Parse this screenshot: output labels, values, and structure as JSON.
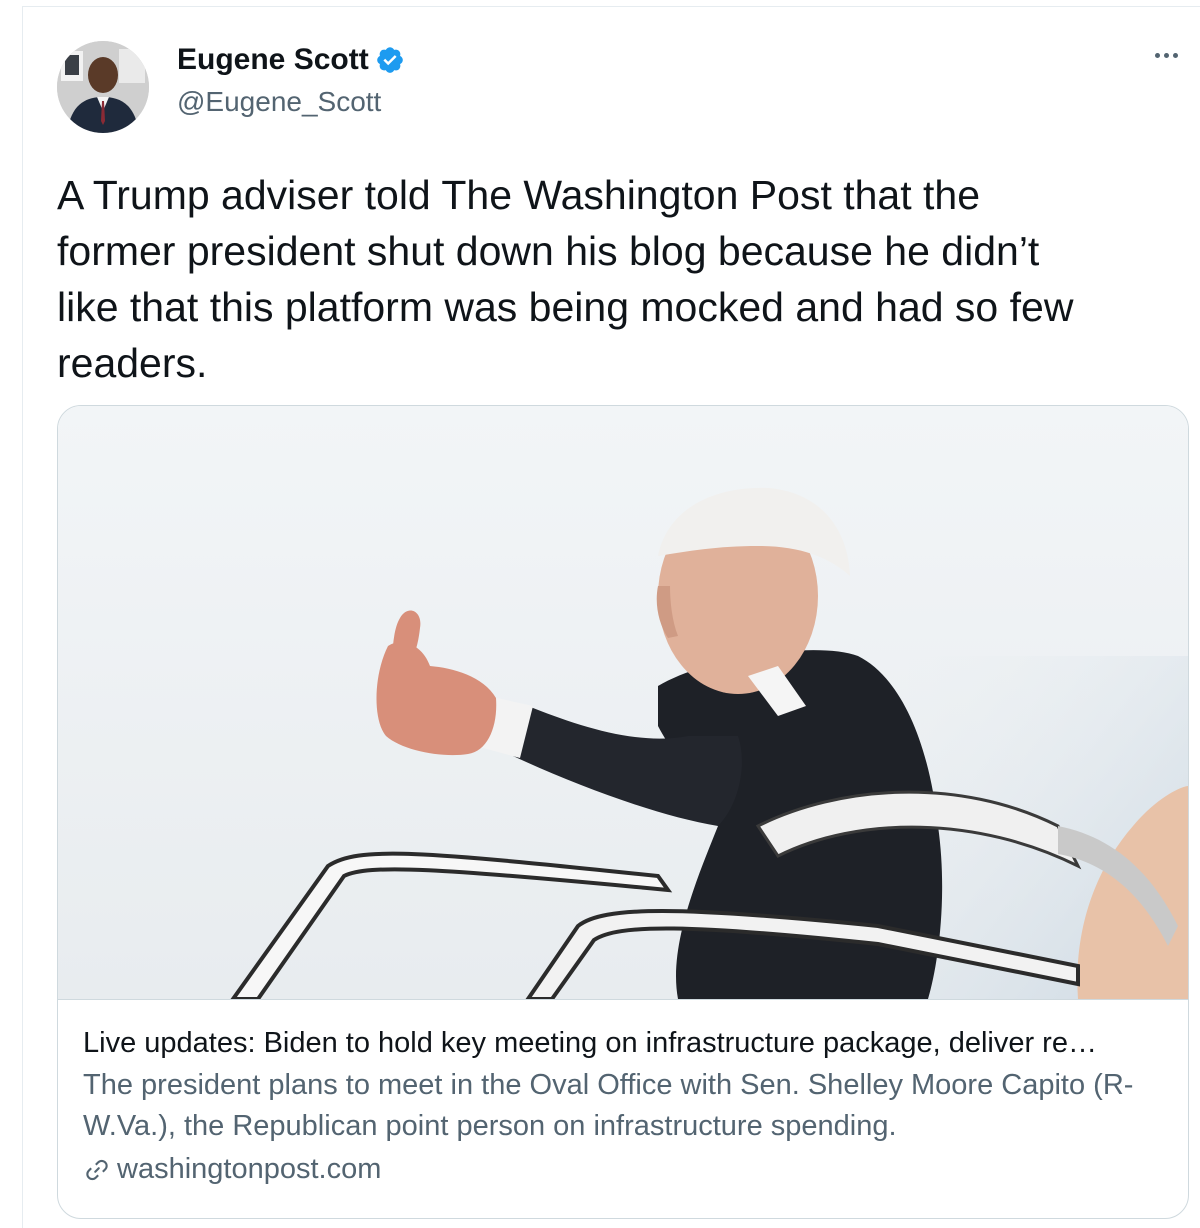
{
  "author": {
    "display_name": "Eugene Scott",
    "handle": "@Eugene_Scott",
    "verified": true,
    "avatar_icon": "profile-photo"
  },
  "more_icon": "ellipsis-icon",
  "tweet": {
    "text": "A Trump adviser told The Washington Post that the\nformer president shut down his blog because he didn’t\nlike that this platform was being mocked and had so few\nreaders."
  },
  "link_card": {
    "title": "Live updates: Biden to hold key meeting on infrastructure package, deliver re…",
    "description": "The president plans to meet in the Oval Office with Sen. Shelley Moore Capito (R-W.Va.), the Republican point person on infrastructure spending.",
    "domain": "washingtonpost.com",
    "domain_icon": "link-icon"
  },
  "colors": {
    "text_primary": "#0f1419",
    "text_secondary": "#536471",
    "verified_blue": "#1d9bf0",
    "border": "#cfd9de"
  }
}
